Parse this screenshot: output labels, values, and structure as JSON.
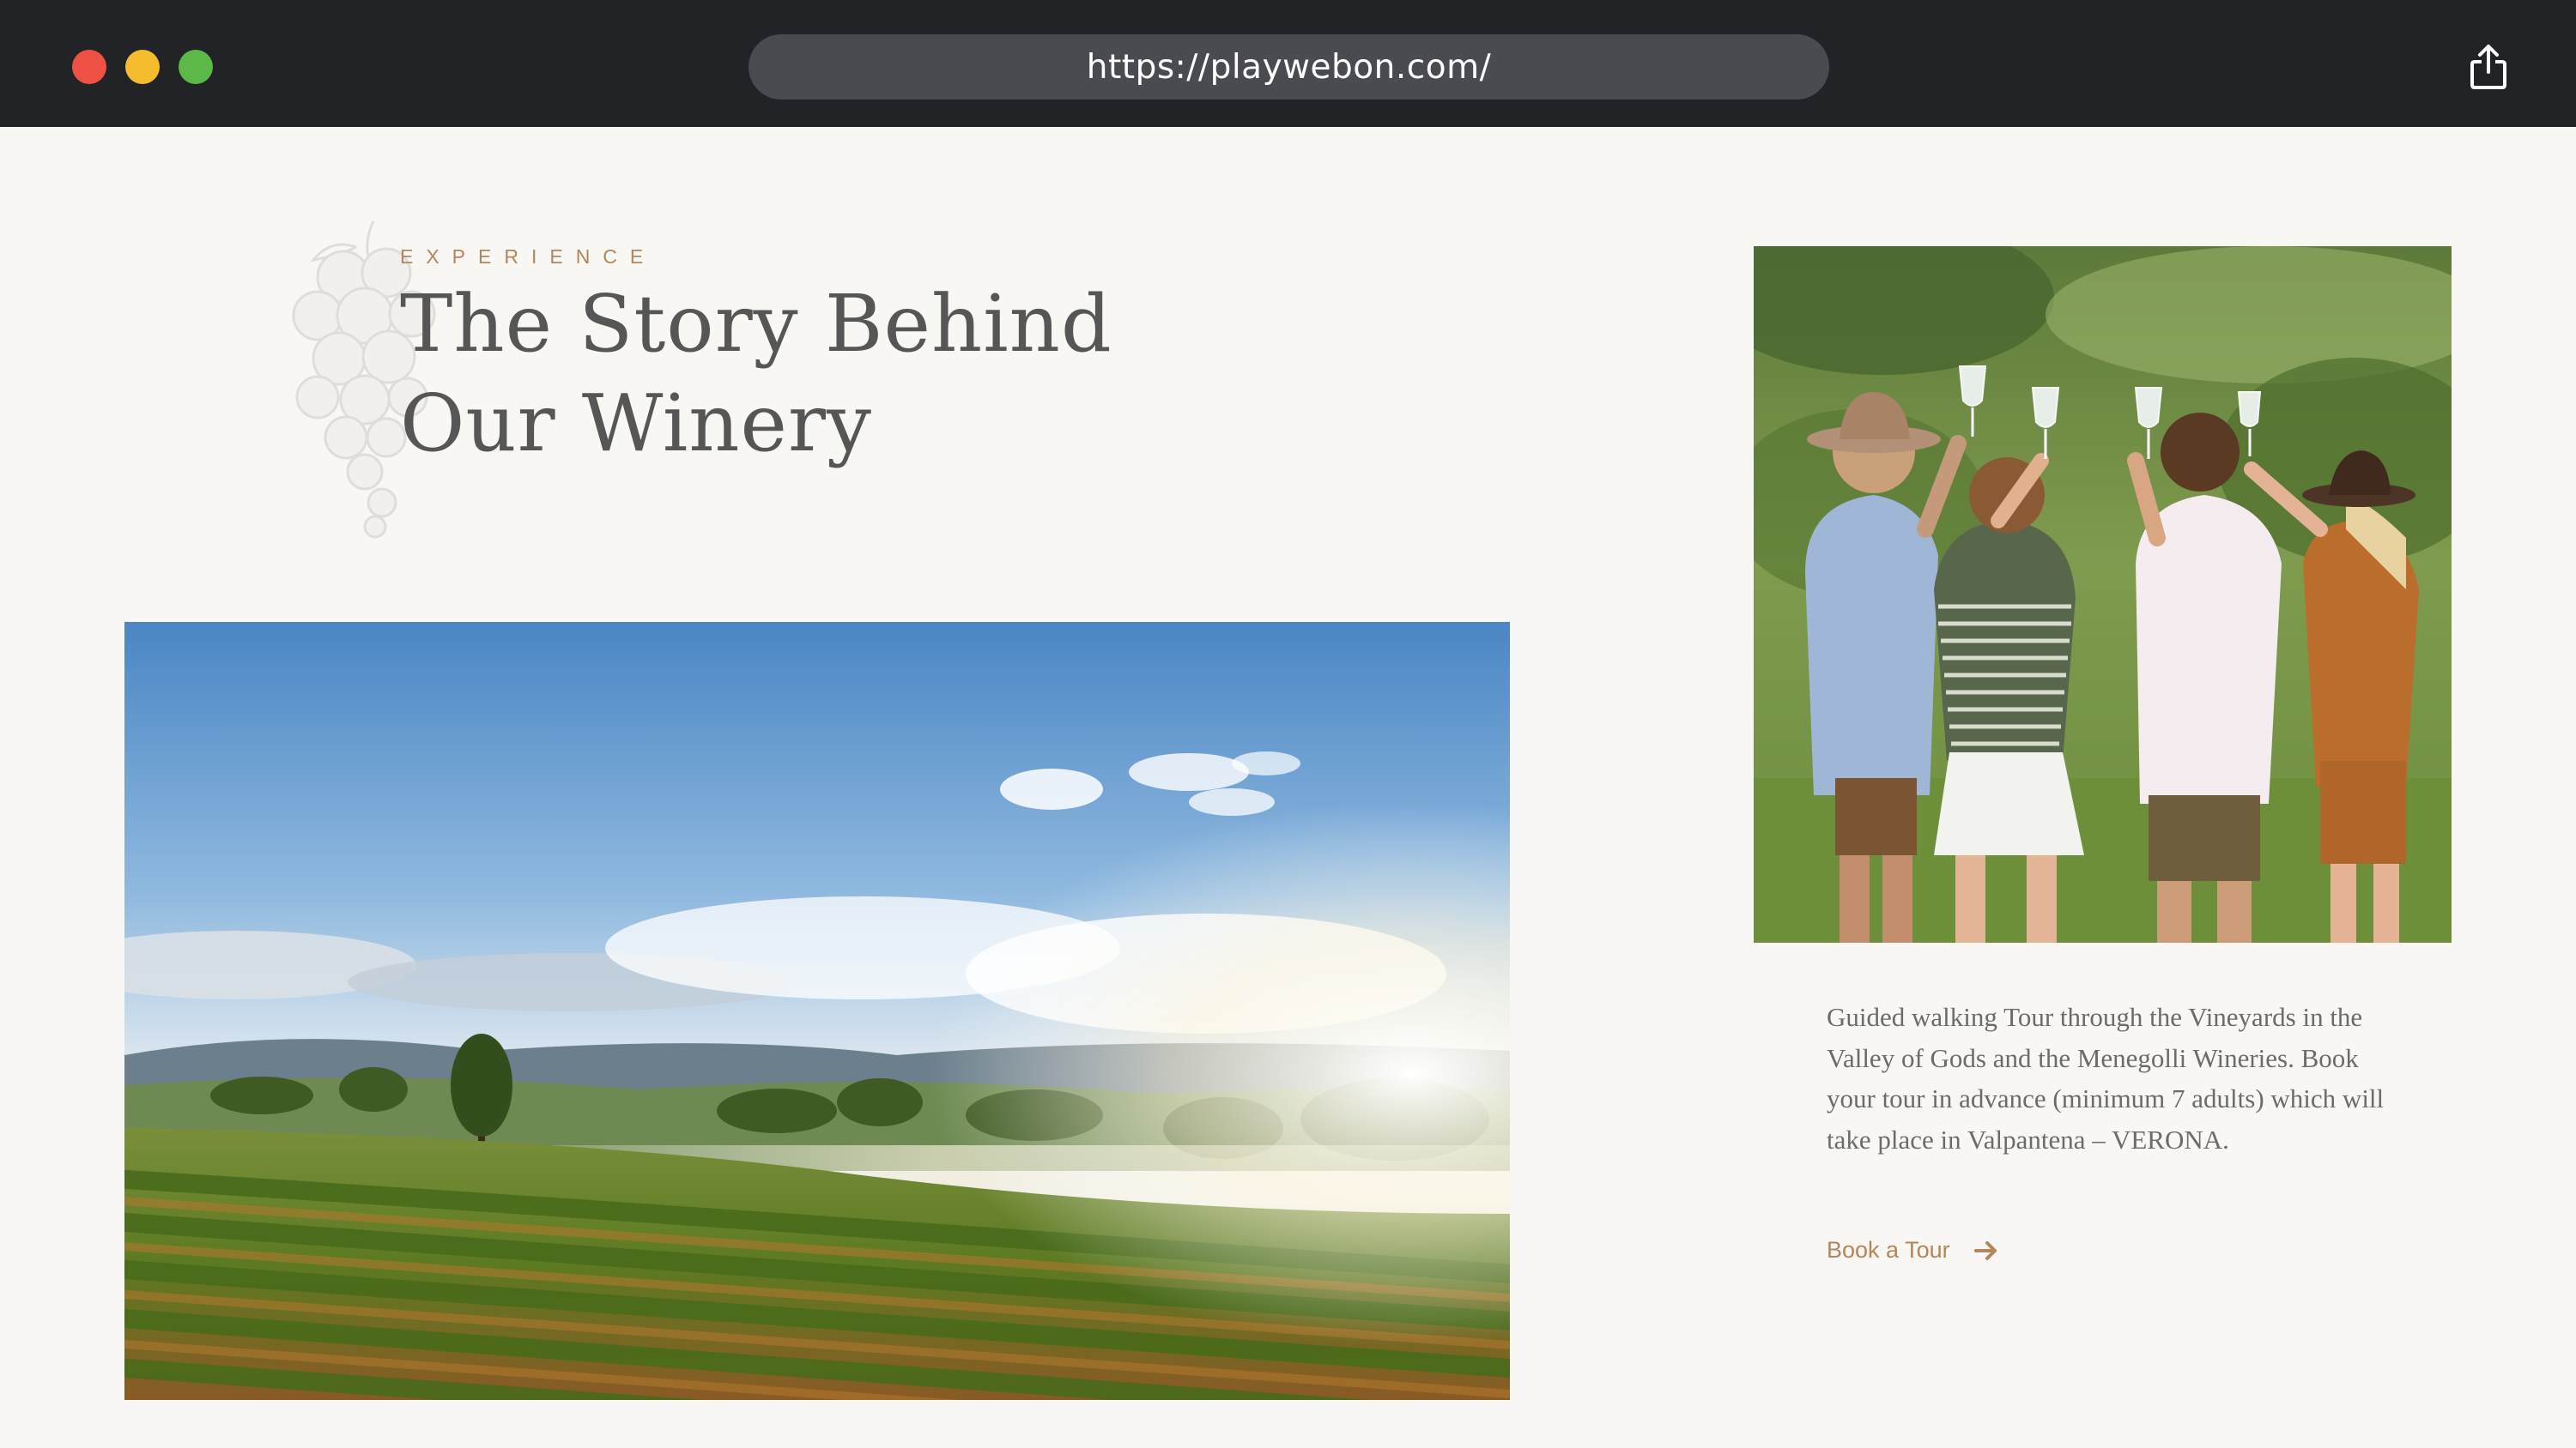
{
  "browser": {
    "url": "https://playwebon.com/",
    "icons": {
      "close": "close-dot-icon",
      "minimize": "minimize-dot-icon",
      "maximize": "maximize-dot-icon",
      "share": "share-icon"
    },
    "colors": {
      "chrome": "#222326",
      "url_bar": "#4a4b50",
      "close": "#ef5144",
      "minimize": "#f5bd2e",
      "maximize": "#5cb947"
    }
  },
  "hero": {
    "eyebrow": "EXPERIENCE",
    "title_line1": "The Story Behind",
    "title_line2": "Our Winery"
  },
  "tour": {
    "description": "Guided walking Tour through the Vineyards in the Valley of Gods and the Menegolli Wineries. Book your tour in advance (minimum 7 adults) which will take place in Valpantena – VERONA.",
    "link_label": "Book a Tour",
    "link_icon": "arrow-right-icon"
  },
  "colors": {
    "background": "#f8f7f4",
    "accent": "#b3875a",
    "heading": "#565656",
    "body_text": "#6b6b6b"
  }
}
